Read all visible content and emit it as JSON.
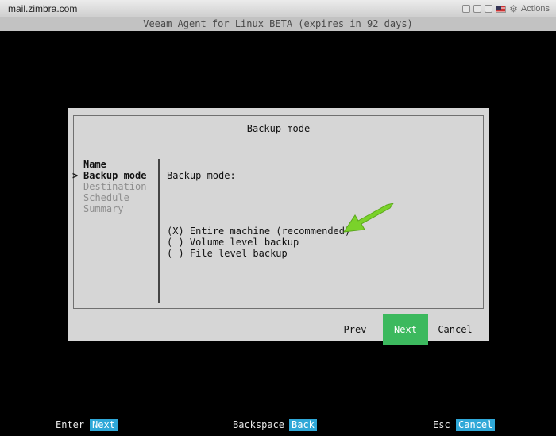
{
  "window": {
    "host_title": "mail.zimbra.com",
    "actions_label": "Actions",
    "icons": [
      "window-icon",
      "window-icon",
      "window-icon",
      "flag-icon",
      "gear-icon"
    ]
  },
  "console": {
    "header": "Veeam Agent for Linux BETA (expires in 92 days)"
  },
  "dialog": {
    "title": "Backup mode",
    "steps": [
      {
        "label": "Name",
        "state": "done",
        "marker": ""
      },
      {
        "label": "Backup mode",
        "state": "current",
        "marker": ">"
      },
      {
        "label": "Destination",
        "state": "pending",
        "marker": ""
      },
      {
        "label": "Schedule",
        "state": "pending",
        "marker": ""
      },
      {
        "label": "Summary",
        "state": "pending",
        "marker": ""
      }
    ],
    "content_label": "Backup mode:",
    "options": [
      {
        "radio": "(X)",
        "label": "Entire machine (recommended)",
        "selected": true
      },
      {
        "radio": "( )",
        "label": "Volume level backup",
        "selected": false
      },
      {
        "radio": "( )",
        "label": "File level backup",
        "selected": false
      }
    ],
    "buttons": {
      "prev": "Prev",
      "next": "Next",
      "cancel": "Cancel"
    },
    "accent_color": "#3cb95e"
  },
  "footer": {
    "items": [
      {
        "key": "Enter",
        "action": "Next"
      },
      {
        "key": "Backspace",
        "action": "Back"
      },
      {
        "key": "Esc",
        "action": "Cancel"
      }
    ],
    "hint_color": "#2fa8d8"
  },
  "annotation": {
    "arrow_color": "#7ad22a",
    "icon": "green-arrow-icon"
  }
}
